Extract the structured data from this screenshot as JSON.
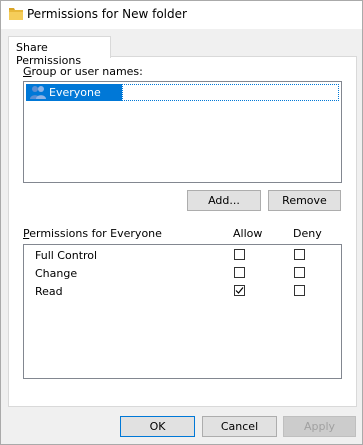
{
  "window": {
    "title": "Permissions for New folder"
  },
  "tab": {
    "label": "Share Permissions"
  },
  "groups": {
    "label_prefix": "G",
    "label_rest": "roup or user names:",
    "items": [
      {
        "name": "Everyone"
      }
    ]
  },
  "buttons": {
    "add": "Add...",
    "remove": "Remove",
    "ok": "OK",
    "cancel": "Cancel",
    "apply": "Apply"
  },
  "permissions": {
    "label_prefix": "P",
    "label_rest": "ermissions for Everyone",
    "allow_header": "Allow",
    "deny_header": "Deny",
    "rows": [
      {
        "name": "Full Control",
        "allow": false,
        "deny": false
      },
      {
        "name": "Change",
        "allow": false,
        "deny": false
      },
      {
        "name": "Read",
        "allow": true,
        "deny": false
      }
    ]
  }
}
